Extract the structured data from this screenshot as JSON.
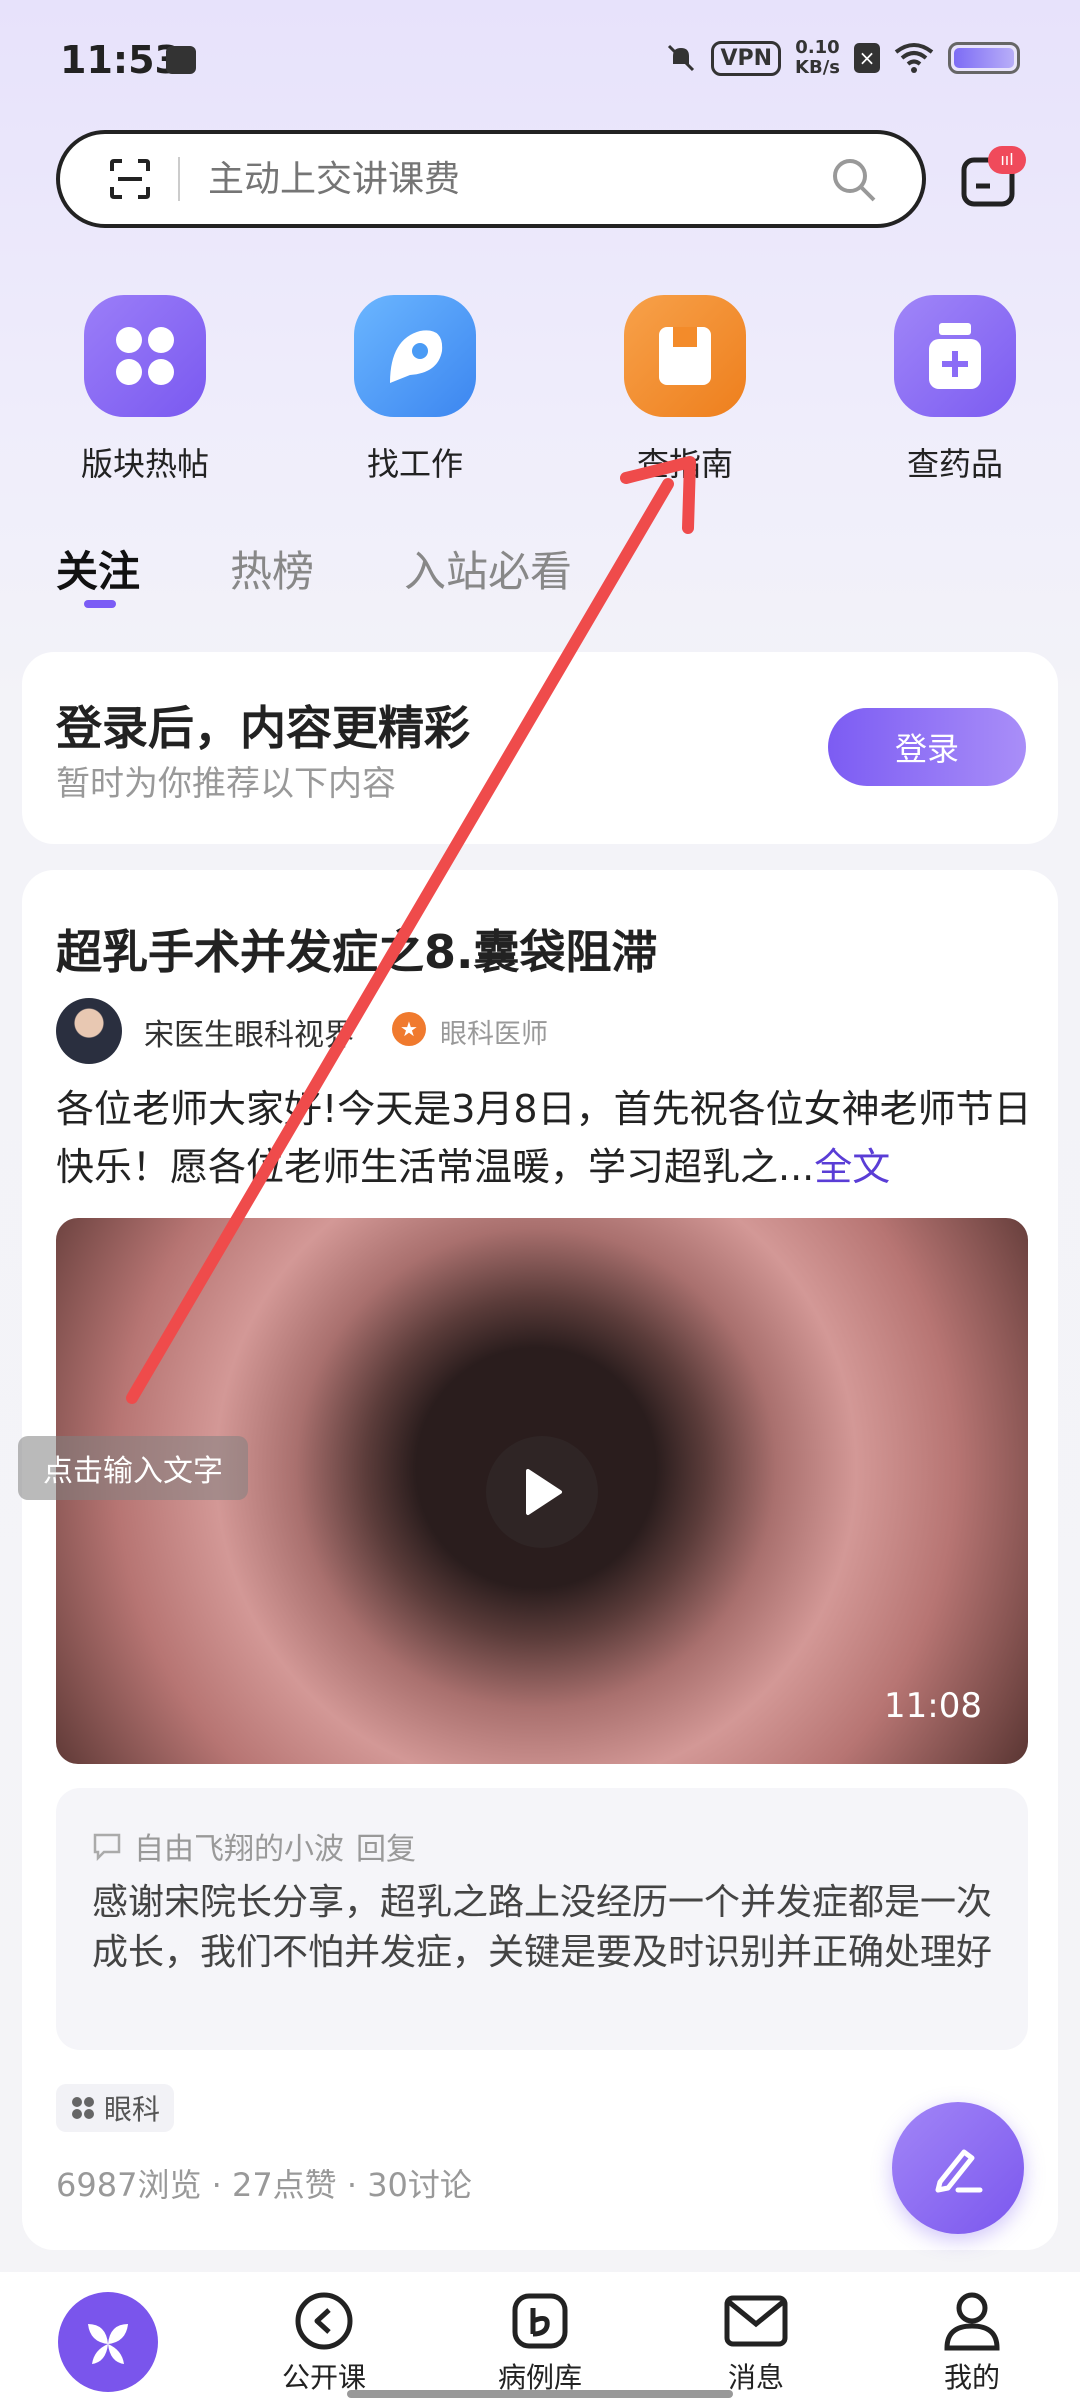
{
  "status_bar": {
    "time": "11:53",
    "vpn": "VPN",
    "speed_value": "0.10",
    "speed_unit": "KB/s"
  },
  "search": {
    "placeholder": "主动上交讲课费"
  },
  "shortcuts": [
    {
      "label": "版块热帖",
      "icon": "grid-icon",
      "color": "#8b6cf6"
    },
    {
      "label": "找工作",
      "icon": "job-icon",
      "color": "#4a9bf5"
    },
    {
      "label": "查指南",
      "icon": "guide-book-icon",
      "color": "#f38b2a"
    },
    {
      "label": "查药品",
      "icon": "medicine-bottle-icon",
      "color": "#8b6cf6"
    }
  ],
  "tabs": [
    {
      "label": "关注",
      "active": true
    },
    {
      "label": "热榜",
      "active": false
    },
    {
      "label": "入站必看",
      "active": false
    }
  ],
  "login_card": {
    "title": "登录后，内容更精彩",
    "subtitle": "暂时为你推荐以下内容",
    "button": "登录"
  },
  "post": {
    "title": "超乳手术并发症之8.囊袋阻滞",
    "author": "宋医生眼科视界",
    "role": "眼科医师",
    "body": "各位老师大家好!今天是3月8日，首先祝各位女神老师节日快乐！愿各位老师生活常温暖，学习超乳之...",
    "full_link": "全文",
    "video_duration": "11:08",
    "reply_user": "自由飞翔的小波",
    "reply_word": "回复",
    "reply_text": "感谢宋院长分享，超乳之路上没经历一个并发症都是一次成长，我们不怕并发症，关键是要及时识别并正确处理好",
    "tag": "眼科",
    "stats": "6987浏览 · 27点赞 · 30讨论"
  },
  "bottom_nav": [
    {
      "label": "",
      "icon": "home-leaf-icon"
    },
    {
      "label": "公开课",
      "icon": "play-course-icon"
    },
    {
      "label": "病例库",
      "icon": "case-library-icon"
    },
    {
      "label": "消息",
      "icon": "mail-icon"
    },
    {
      "label": "我的",
      "icon": "profile-icon"
    }
  ],
  "overlay": {
    "hint": "点击输入文字",
    "arrow_color": "#ef4b4b"
  }
}
